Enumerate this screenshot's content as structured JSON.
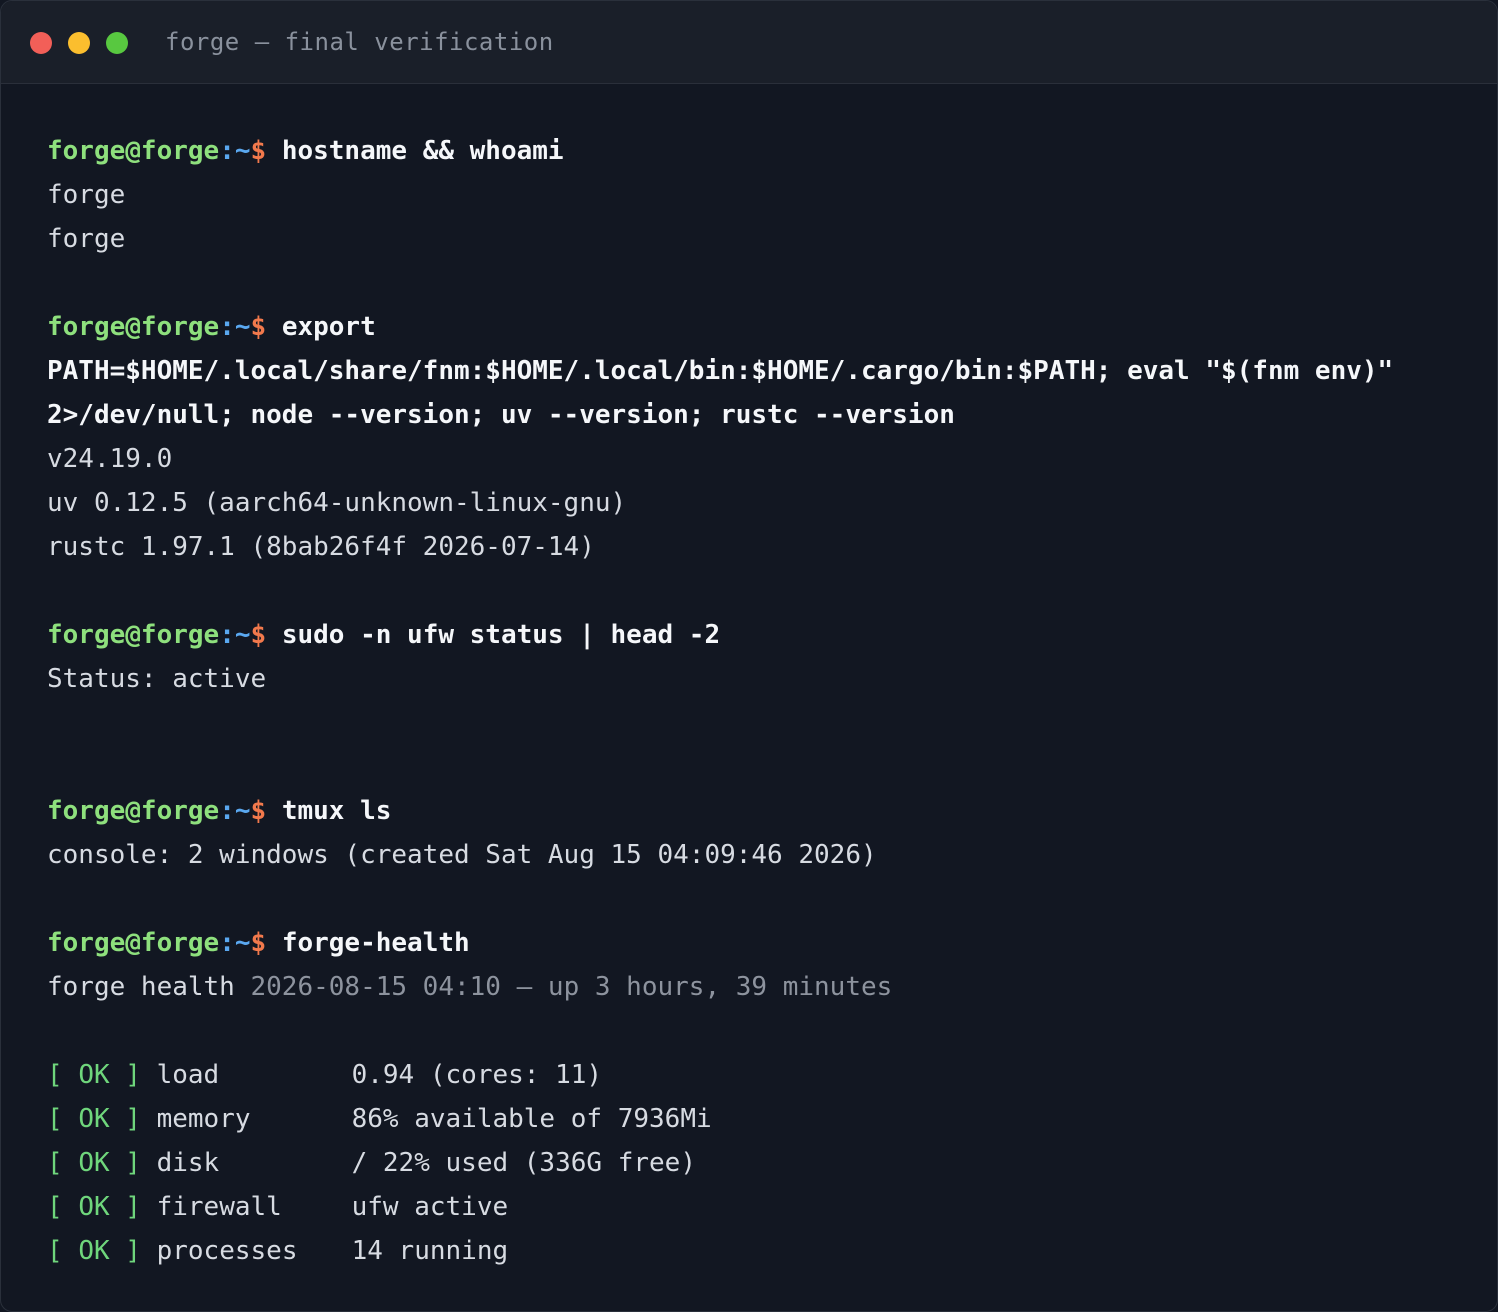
{
  "window": {
    "title": "forge — final verification"
  },
  "prompt": {
    "user_host": "forge@forge",
    "colon": ":",
    "path": "~",
    "symbol": "$"
  },
  "colors": {
    "background": "#121722",
    "titlebar": "#1a1f29",
    "prompt_user": "#8ee07d",
    "prompt_path": "#5aa8f0",
    "prompt_symbol": "#f2794c",
    "ok": "#6fd67c"
  },
  "session": {
    "cmd1": "hostname && whoami",
    "out1": [
      "forge",
      "forge"
    ],
    "cmd2": [
      "export",
      "PATH=$HOME/.local/share/fnm:$HOME/.local/bin:$HOME/.cargo/bin:$PATH; eval \"$(fnm env)\"",
      "2>/dev/null; node --version; uv --version; rustc --version"
    ],
    "out2": [
      "v24.19.0",
      "uv 0.12.5 (aarch64-unknown-linux-gnu)",
      "rustc 1.97.1 (8bab26f4f 2026-07-14)"
    ],
    "cmd3": "sudo -n ufw status | head -2",
    "out3": [
      "Status: active"
    ],
    "cmd4": "tmux ls",
    "out4": [
      "console: 2 windows (created Sat Aug 15 04:09:46 2026)"
    ],
    "cmd5": "forge-health",
    "health_title": "forge health",
    "health_meta": "2026-08-15 04:10 — up 3 hours, 39 minutes",
    "checks": [
      {
        "open": "[ ",
        "status": "OK",
        "close": " ]",
        "label": "load",
        "value": "0.94 (cores: 11)"
      },
      {
        "open": "[ ",
        "status": "OK",
        "close": " ]",
        "label": "memory",
        "value": "86% available of 7936Mi"
      },
      {
        "open": "[ ",
        "status": "OK",
        "close": " ]",
        "label": "disk",
        "value": "/ 22% used (336G free)"
      },
      {
        "open": "[ ",
        "status": "OK",
        "close": " ]",
        "label": "firewall",
        "value": "ufw active"
      },
      {
        "open": "[ ",
        "status": "OK",
        "close": " ]",
        "label": "processes",
        "value": "14 running"
      }
    ]
  }
}
